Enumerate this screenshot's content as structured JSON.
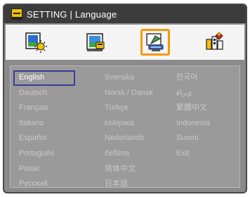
{
  "title": {
    "text": "SETTING | Language",
    "icon": "setting-monitor-icon"
  },
  "tabs": [
    {
      "icon": "image-settings-icon",
      "selected": false
    },
    {
      "icon": "display-settings-icon",
      "selected": false
    },
    {
      "icon": "setting-icon",
      "selected": true
    },
    {
      "icon": "options-icon",
      "selected": false
    }
  ],
  "languages": {
    "column1": [
      "English",
      "Deutsch",
      "Français",
      "Italiano",
      "Español",
      "Português",
      "Polski",
      "Русский"
    ],
    "column2": [
      "Svenska",
      "Norsk / Dansk",
      "Türkçe",
      "ελληνικά",
      "Nederlands",
      "čeština",
      "简体中文",
      "日本語"
    ],
    "column3": [
      "한국어",
      "ﻱﺭﺎﻓ",
      "繁體中文",
      "Indonesia",
      "Suomi",
      "Exit"
    ]
  },
  "selected_language": "English",
  "colors": {
    "highlight": "#f39a00",
    "selection_border": "#3c3c9a",
    "title_bar": "#3c3c3c",
    "panel": "#8a8a8a"
  }
}
